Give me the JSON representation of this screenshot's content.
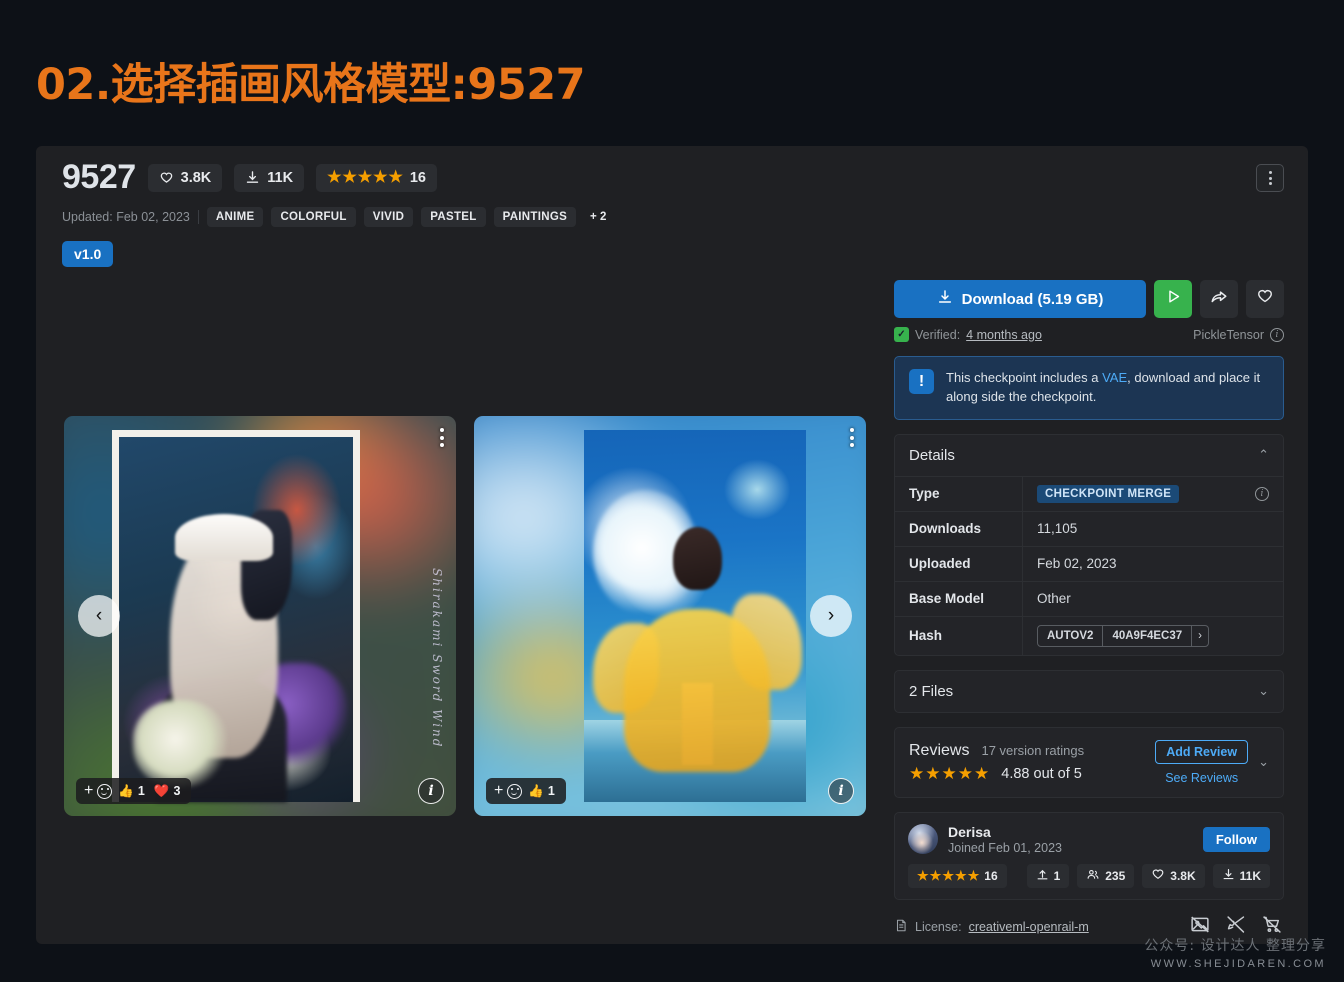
{
  "page": {
    "title": "02.选择插画风格模型:9527",
    "title_color": "#e8751a",
    "background": "#0d1117"
  },
  "model": {
    "name": "9527",
    "likes": "3.8K",
    "downloads_short": "11K",
    "rating_count": "16",
    "updated": "Updated: Feb 02, 2023",
    "tags": [
      "ANIME",
      "COLORFUL",
      "VIVID",
      "PASTEL",
      "PAINTINGS"
    ],
    "tags_more": "+ 2",
    "version_badge": "v1.0",
    "kebab_label": "More options"
  },
  "download": {
    "label": "Download (5.19 GB)",
    "verified_prefix": "Verified:",
    "verified_when": "4 months ago",
    "format": "PickleTensor",
    "run_label": "Run model",
    "share_label": "Share",
    "favorite_label": "Favorite",
    "accent": "#1971c2",
    "green": "#37b24d"
  },
  "alert": {
    "text_before": "This checkpoint includes a ",
    "link": "VAE",
    "text_after": ", download and place it along side the checkpoint."
  },
  "details": {
    "heading": "Details",
    "rows": [
      {
        "label": "Type",
        "value": "CHECKPOINT MERGE",
        "kind": "badge"
      },
      {
        "label": "Downloads",
        "value": "11,105",
        "kind": "text"
      },
      {
        "label": "Uploaded",
        "value": "Feb 02, 2023",
        "kind": "text"
      },
      {
        "label": "Base Model",
        "value": "Other",
        "kind": "text"
      },
      {
        "label": "Hash",
        "value": "40A9F4EC37",
        "kind": "hash",
        "algo": "AUTOV2"
      }
    ]
  },
  "files": {
    "heading": "2 Files"
  },
  "reviews": {
    "title": "Reviews",
    "subtitle": "17 version ratings",
    "score": "4.88 out of 5",
    "stars": 5,
    "add_review": "Add Review",
    "see_reviews": "See Reviews"
  },
  "author": {
    "name": "Derisa",
    "joined": "Joined Feb 01, 2023",
    "follow": "Follow",
    "rating_count": "16",
    "uploads": "1",
    "followers": "235",
    "likes": "3.8K",
    "downloads": "11K"
  },
  "license": {
    "label": "License:",
    "name": "creativeml-openrail-m",
    "restrictions": [
      "no-image-icon",
      "no-brush-icon",
      "no-cart-icon"
    ]
  },
  "gallery": {
    "prev_label": "Previous image",
    "next_label": "Next image",
    "items": [
      {
        "name": "maid-girl-illustration",
        "signature": "Shirakami Sword Wind",
        "reactions": [
          {
            "icon": "thumbs-up",
            "count": "1"
          },
          {
            "icon": "heart",
            "count": "3"
          }
        ]
      },
      {
        "name": "yellow-dress-sky-illustration",
        "signature": "",
        "reactions": [
          {
            "icon": "thumbs-up",
            "count": "1"
          }
        ]
      }
    ]
  },
  "watermark": {
    "line1": "公众号: 设计达人 整理分享",
    "line2": "WWW.SHEJIDAREN.COM"
  }
}
